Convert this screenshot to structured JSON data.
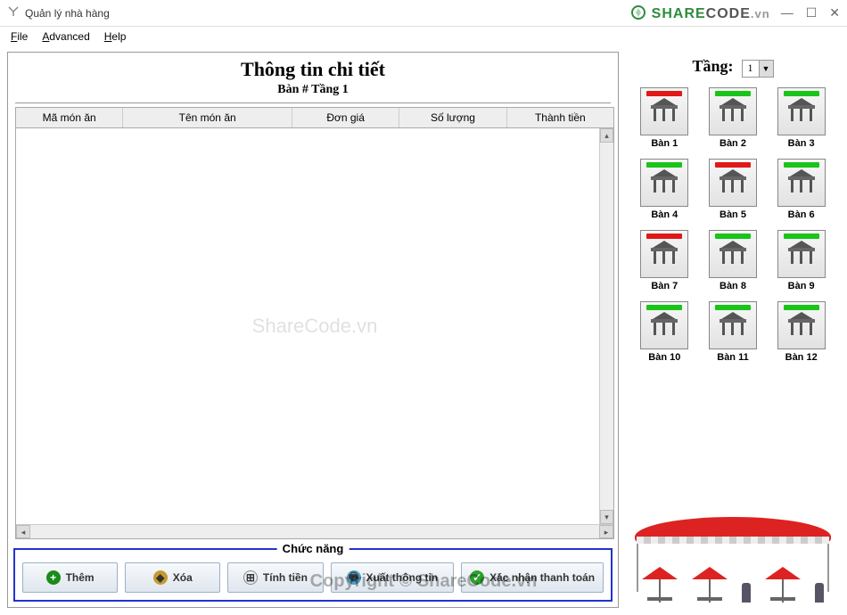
{
  "window": {
    "title": "Quản lý nhà hàng",
    "controls": {
      "minimize": "—",
      "maximize": "☐",
      "close": "✕"
    }
  },
  "logo": {
    "share": "SHARE",
    "code": "CODE",
    "vn": ".vn"
  },
  "menu": {
    "file": "File",
    "advanced": "Advanced",
    "help": "Help"
  },
  "details": {
    "title": "Thông tin chi tiết",
    "subtitle": "Bàn # Tầng 1",
    "columns": {
      "code": "Mã món ăn",
      "name": "Tên món ăn",
      "price": "Đơn giá",
      "qty": "Số lượng",
      "total": "Thành tiền"
    }
  },
  "functions": {
    "legend": "Chức năng",
    "add": "Thêm",
    "delete": "Xóa",
    "calc": "Tính tiền",
    "export": "Xuất thông tin",
    "confirm": "Xác nhận thanh toán"
  },
  "floor": {
    "label": "Tầng:",
    "value": "1"
  },
  "tables": [
    {
      "name": "Bàn 1",
      "status": "red"
    },
    {
      "name": "Bàn 2",
      "status": "green"
    },
    {
      "name": "Bàn 3",
      "status": "green"
    },
    {
      "name": "Bàn 4",
      "status": "green"
    },
    {
      "name": "Bàn 5",
      "status": "red"
    },
    {
      "name": "Bàn 6",
      "status": "green"
    },
    {
      "name": "Bàn 7",
      "status": "red"
    },
    {
      "name": "Bàn 8",
      "status": "green"
    },
    {
      "name": "Bàn 9",
      "status": "green"
    },
    {
      "name": "Bàn 10",
      "status": "green"
    },
    {
      "name": "Bàn 11",
      "status": "green"
    },
    {
      "name": "Bàn 12",
      "status": "green"
    }
  ],
  "watermark": {
    "center": "ShareCode.vn",
    "bottom": "Copyright © ShareCode.vn"
  }
}
